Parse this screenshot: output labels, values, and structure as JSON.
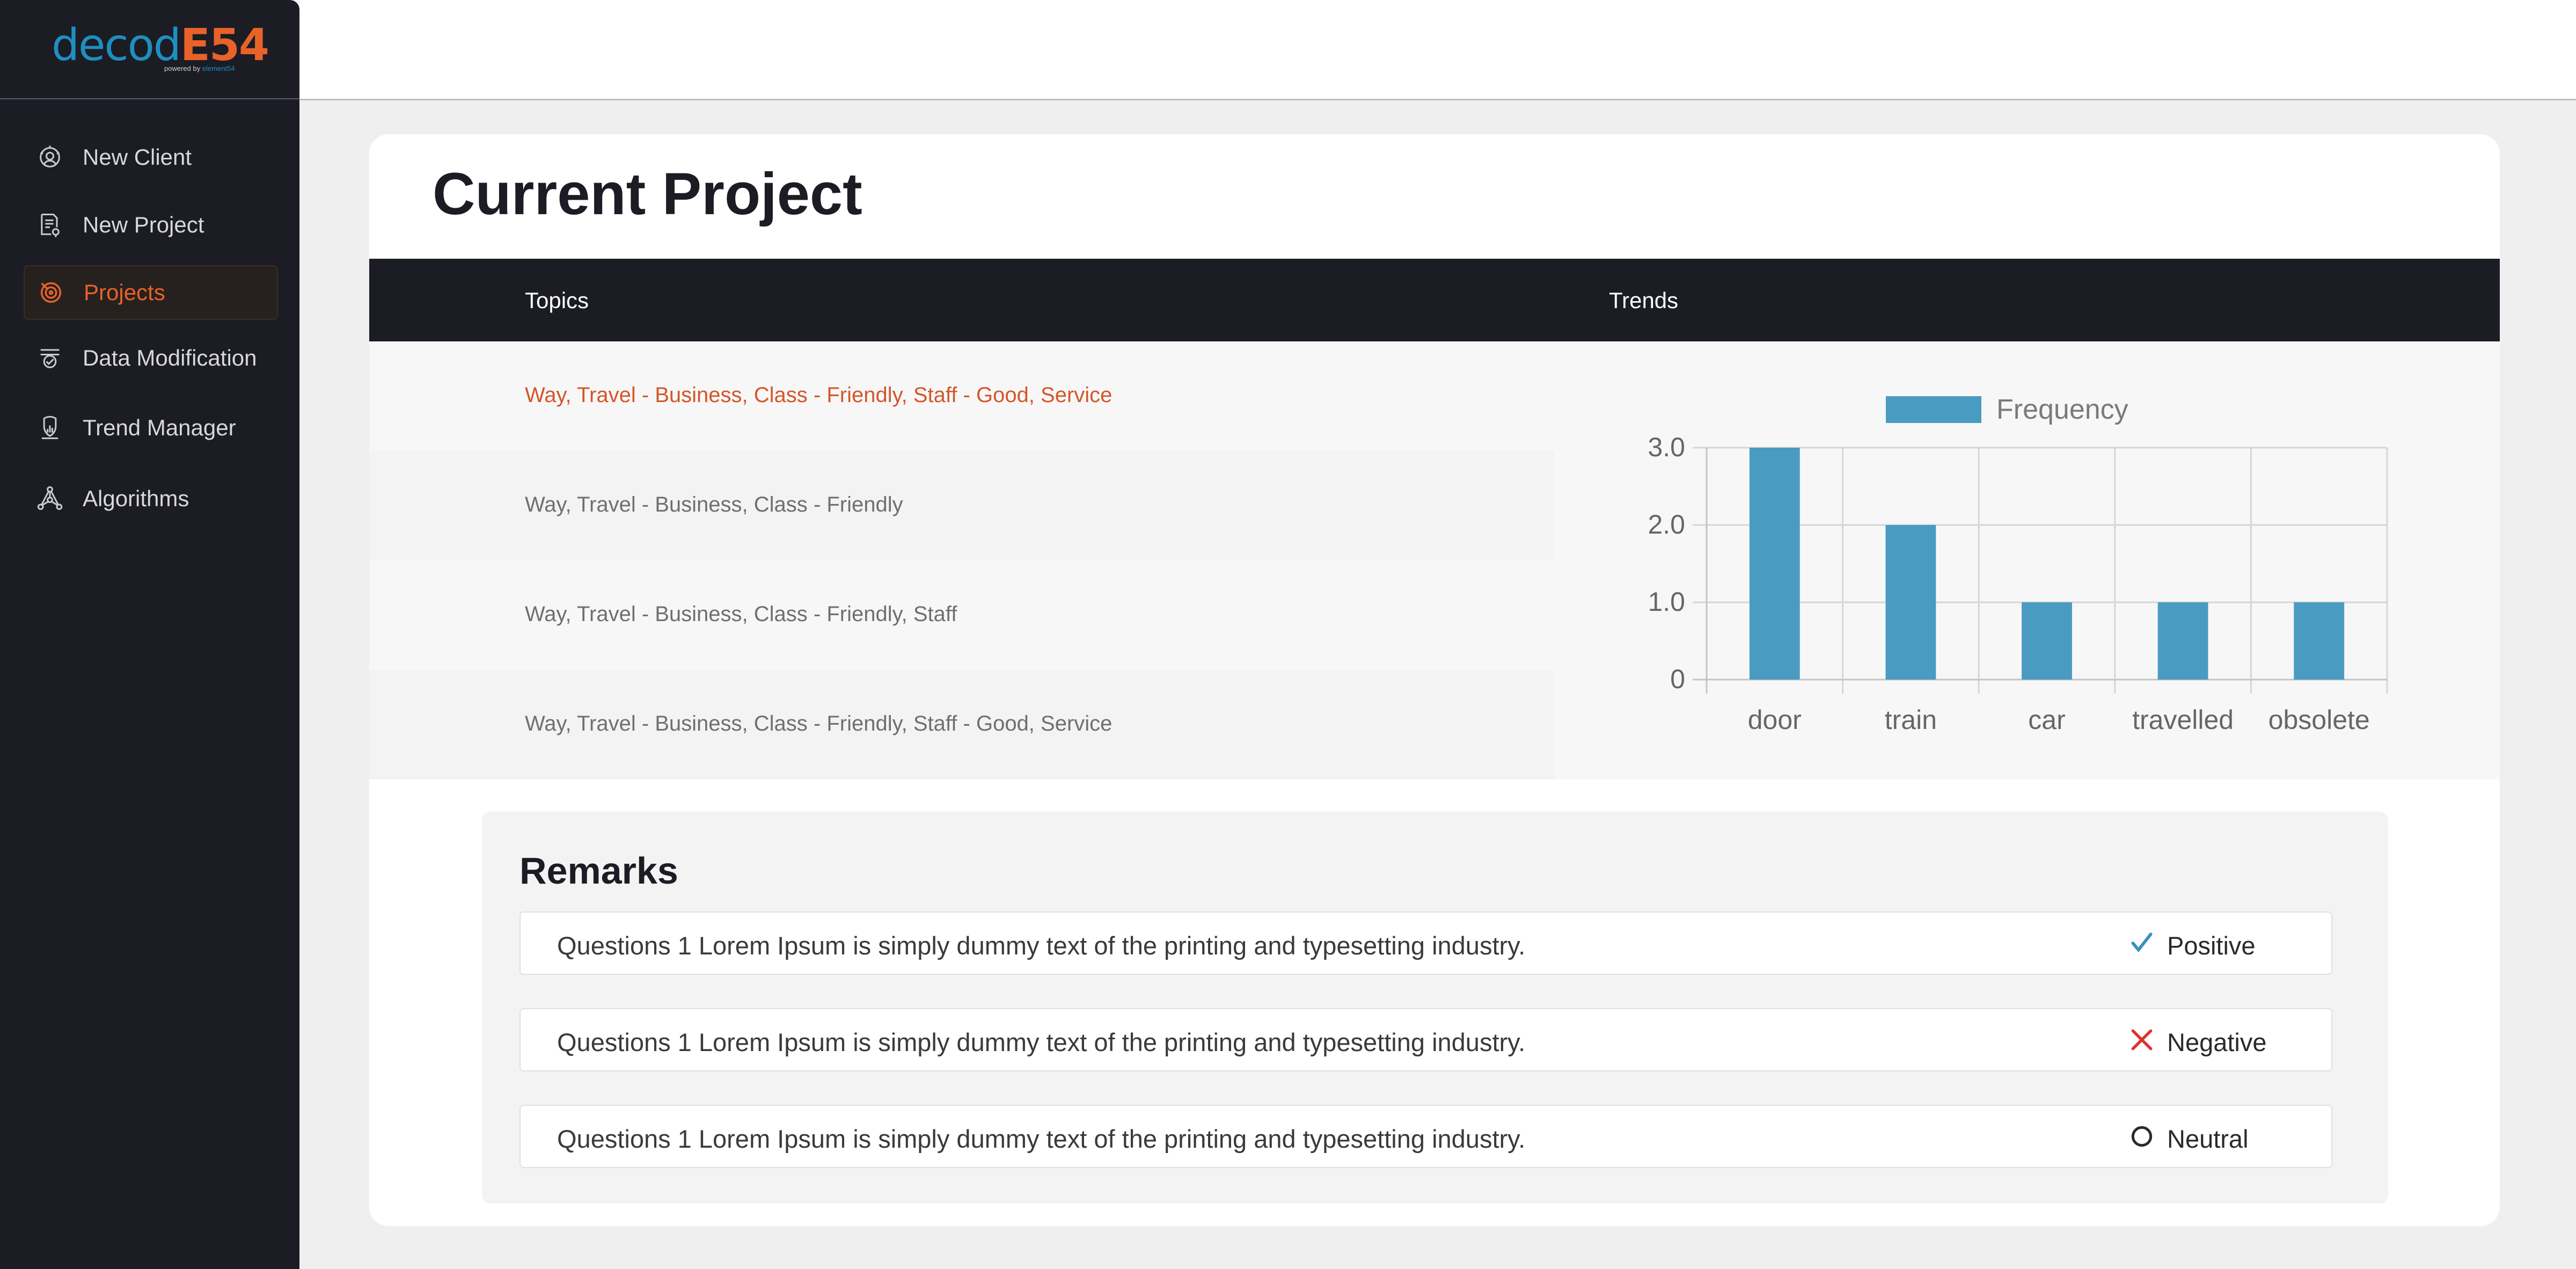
{
  "brand": {
    "logo_main": "decod",
    "logo_accent": "E54",
    "tagline_prefix": "powered by",
    "tagline_accent": "element54"
  },
  "sidebar": {
    "items": [
      {
        "label": "New Client",
        "icon": "client-face-icon",
        "active": false
      },
      {
        "label": "New Project",
        "icon": "document-pin-icon",
        "active": false
      },
      {
        "label": "Projects",
        "icon": "target-icon",
        "active": true
      },
      {
        "label": "Data Modification",
        "icon": "data-modify-icon",
        "active": false
      },
      {
        "label": "Trend Manager",
        "icon": "trend-manager-icon",
        "active": false
      },
      {
        "label": "Algorithms",
        "icon": "network-icon",
        "active": false
      }
    ]
  },
  "main": {
    "title": "Current Project",
    "table": {
      "headers": {
        "topics": "Topics",
        "trends": "Trends"
      },
      "topics": [
        "Way, Travel - Business, Class - Friendly, Staff - Good, Service",
        "Way, Travel - Business, Class - Friendly",
        "Way, Travel - Business, Class - Friendly, Staff",
        "Way, Travel - Business, Class - Friendly, Staff - Good, Service"
      ]
    },
    "remarks": {
      "title": "Remarks",
      "items": [
        {
          "text": "Questions 1 Lorem Ipsum is simply dummy text of the printing and typesetting industry.",
          "sentiment": "Positive",
          "icon": "check-icon"
        },
        {
          "text": "Questions 1 Lorem Ipsum is simply dummy text of the printing and typesetting industry.",
          "sentiment": "Negative",
          "icon": "cross-icon"
        },
        {
          "text": "Questions 1 Lorem Ipsum is simply dummy text of the printing and typesetting industry.",
          "sentiment": "Neutral",
          "icon": "circle-icon"
        }
      ]
    }
  },
  "colors": {
    "accent": "#e8622a",
    "sidebar_bg": "#1b1c24",
    "bar": "#4a9bc1",
    "positive": "#3a8fc0",
    "negative": "#e0312b",
    "neutral": "#2a2a2a"
  },
  "chart_data": {
    "type": "bar",
    "categories": [
      "door",
      "train",
      "car",
      "travelled",
      "obsolete"
    ],
    "series": [
      {
        "name": "Frequency",
        "values": [
          3,
          2,
          1,
          1,
          1
        ]
      }
    ],
    "ylim": [
      0,
      3
    ],
    "yticks": [
      "0",
      "1.0",
      "2.0",
      "3.0"
    ],
    "legend": "top",
    "grid": true
  }
}
